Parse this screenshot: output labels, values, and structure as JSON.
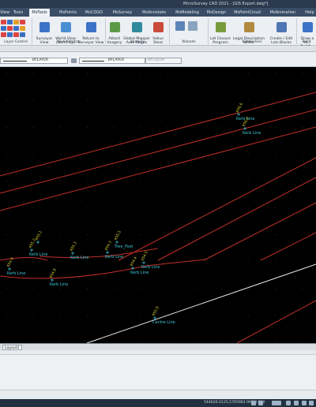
{
  "window": {
    "title": "MicroSurvey CAD 2021 - [GIS Export.dwg*]"
  },
  "tabs": [
    {
      "label": "View"
    },
    {
      "label": "Tools"
    },
    {
      "label": "MsTools"
    },
    {
      "label": "MsPoints"
    },
    {
      "label": "MsCOGO"
    },
    {
      "label": "MsSurvey"
    },
    {
      "label": "MsAnnotate"
    },
    {
      "label": "MsModeling"
    },
    {
      "label": "MsDesign"
    },
    {
      "label": "MsPointCloud"
    },
    {
      "label": "MsAnimation"
    },
    {
      "label": "Help"
    }
  ],
  "ribbon": {
    "surveyor_view": "Surveyor\nView",
    "world_view": "World View\n(North Up)",
    "return_view": "Return to\nSurveyor View",
    "attach_imagery": "Attach\nImagery",
    "global_mapper": "Global Mapper\nAuto-Regen",
    "vallus_store": "Vallus\nStore",
    "lot_closure": "Lot Closure\nProgram",
    "legal_writer": "Legal Description\nWriter",
    "create_lots": "Create / Edit\nLots Blocks",
    "draw_building": "Draw a M...\nBuildi...",
    "groups": {
      "layer_control": "Layer Control",
      "view_rotation": "View Rotation",
      "imagery": "Imagery",
      "wizards": "Wizards",
      "subdivision": "Subdivision",
      "build": "Build"
    }
  },
  "properties": {
    "linetype": "BYLAYER",
    "lineweight": "BYLAYER",
    "color": "BYCOLOR"
  },
  "drawing": {
    "points": [
      {
        "num": "456.6",
        "code": "Kerb Line"
      },
      {
        "num": "456.9",
        "code": "Kerb Line"
      },
      {
        "num": "455.1",
        "code": ""
      },
      {
        "num": "455.2",
        "code": "Kerb Line"
      },
      {
        "num": "454.9",
        "code": "Kerb Line"
      },
      {
        "num": "455.5",
        "code": "Tree_Post"
      },
      {
        "num": "455.3",
        "code": "Kerb Line"
      },
      {
        "num": "454.4",
        "code": "Kerb Line"
      },
      {
        "num": "454.5",
        "code": "Kerb Line"
      },
      {
        "num": "454.8",
        "code": "Kerb Line"
      },
      {
        "num": "454.3",
        "code": "Kerb Line"
      },
      {
        "num": "455.0",
        "code": "Centre Line"
      }
    ],
    "colors": {
      "background": "#000000",
      "red_lines": "#c0302a",
      "white_line": "#e8e8e8",
      "labels_yellow": "#d8d030",
      "labels_cyan": "#3ec8d8"
    }
  },
  "layout_tab": "Layout2",
  "status": {
    "coordinates": "544626.0125,5765983.997,0.000"
  }
}
